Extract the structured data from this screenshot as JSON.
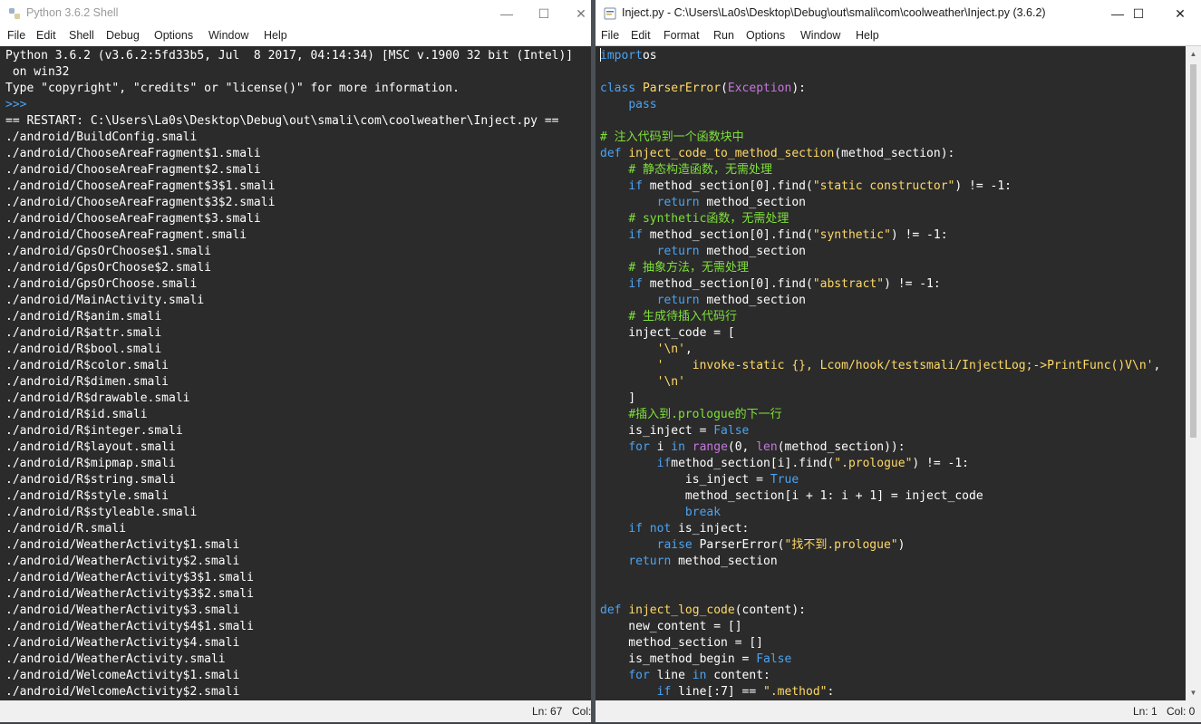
{
  "shell": {
    "title": "Python 3.6.2 Shell",
    "menu": [
      "File",
      "Edit",
      "Shell",
      "Debug",
      "Options",
      "Window",
      "Help"
    ],
    "banner": [
      "Python 3.6.2 (v3.6.2:5fd33b5, Jul  8 2017, 04:14:34) [MSC v.1900 32 bit (Intel)]",
      " on win32",
      "Type \"copyright\", \"credits\" or \"license()\" for more information."
    ],
    "prompt": ">>> ",
    "restart_line": "== RESTART: C:\\Users\\La0s\\Desktop\\Debug\\out\\smali\\com\\coolweather\\Inject.py ==",
    "output": [
      "./android/BuildConfig.smali",
      "./android/ChooseAreaFragment$1.smali",
      "./android/ChooseAreaFragment$2.smali",
      "./android/ChooseAreaFragment$3$1.smali",
      "./android/ChooseAreaFragment$3$2.smali",
      "./android/ChooseAreaFragment$3.smali",
      "./android/ChooseAreaFragment.smali",
      "./android/GpsOrChoose$1.smali",
      "./android/GpsOrChoose$2.smali",
      "./android/GpsOrChoose.smali",
      "./android/MainActivity.smali",
      "./android/R$anim.smali",
      "./android/R$attr.smali",
      "./android/R$bool.smali",
      "./android/R$color.smali",
      "./android/R$dimen.smali",
      "./android/R$drawable.smali",
      "./android/R$id.smali",
      "./android/R$integer.smali",
      "./android/R$layout.smali",
      "./android/R$mipmap.smali",
      "./android/R$string.smali",
      "./android/R$style.smali",
      "./android/R$styleable.smali",
      "./android/R.smali",
      "./android/WeatherActivity$1.smali",
      "./android/WeatherActivity$2.smali",
      "./android/WeatherActivity$3$1.smali",
      "./android/WeatherActivity$3$2.smali",
      "./android/WeatherActivity$3.smali",
      "./android/WeatherActivity$4$1.smali",
      "./android/WeatherActivity$4.smali",
      "./android/WeatherActivity.smali",
      "./android/WelcomeActivity$1.smali",
      "./android/WelcomeActivity$2.smali"
    ],
    "status": {
      "ln": "Ln: 67",
      "col": "Col:"
    }
  },
  "editor": {
    "title": "Inject.py - C:\\Users\\La0s\\Desktop\\Debug\\out\\smali\\com\\coolweather\\Inject.py (3.6.2)",
    "menu": [
      "File",
      "Edit",
      "Format",
      "Run",
      "Options",
      "Window",
      "Help"
    ],
    "code": [
      [
        [
          "kw",
          "import"
        ],
        [
          "",
          "os"
        ]
      ],
      [],
      [
        [
          "kw",
          "class "
        ],
        [
          "cls",
          "ParserError"
        ],
        [
          "",
          "("
        ],
        [
          "bi",
          "Exception"
        ],
        [
          "",
          "):"
        ]
      ],
      [
        [
          "",
          "    "
        ],
        [
          "kw",
          "pass"
        ]
      ],
      [],
      [
        [
          "cm",
          "# 注入代码到一个函数块中"
        ]
      ],
      [
        [
          "kw",
          "def "
        ],
        [
          "cls",
          "inject_code_to_method_section"
        ],
        [
          "",
          "(method_section):"
        ]
      ],
      [
        [
          "",
          "    "
        ],
        [
          "cm",
          "# 静态构造函数，无需处理"
        ]
      ],
      [
        [
          "",
          "    "
        ],
        [
          "kw",
          "if"
        ],
        [
          "",
          " method_section[0].find("
        ],
        [
          "st",
          "\"static constructor\""
        ],
        [
          "",
          ") != -1:"
        ]
      ],
      [
        [
          "",
          "        "
        ],
        [
          "kw",
          "return"
        ],
        [
          "",
          " method_section"
        ]
      ],
      [
        [
          "",
          "    "
        ],
        [
          "cm",
          "# synthetic函数，无需处理"
        ]
      ],
      [
        [
          "",
          "    "
        ],
        [
          "kw",
          "if"
        ],
        [
          "",
          " method_section[0].find("
        ],
        [
          "st",
          "\"synthetic\""
        ],
        [
          "",
          ") != -1:"
        ]
      ],
      [
        [
          "",
          "        "
        ],
        [
          "kw",
          "return"
        ],
        [
          "",
          " method_section"
        ]
      ],
      [
        [
          "",
          "    "
        ],
        [
          "cm",
          "# 抽象方法，无需处理"
        ]
      ],
      [
        [
          "",
          "    "
        ],
        [
          "kw",
          "if"
        ],
        [
          "",
          " method_section[0].find("
        ],
        [
          "st",
          "\"abstract\""
        ],
        [
          "",
          ") != -1:"
        ]
      ],
      [
        [
          "",
          "        "
        ],
        [
          "kw",
          "return"
        ],
        [
          "",
          " method_section"
        ]
      ],
      [
        [
          "",
          "    "
        ],
        [
          "cm",
          "# 生成待插入代码行"
        ]
      ],
      [
        [
          "",
          "    inject_code = ["
        ]
      ],
      [
        [
          "",
          "        "
        ],
        [
          "st",
          "'\\n'"
        ],
        [
          "",
          ","
        ]
      ],
      [
        [
          "",
          "        "
        ],
        [
          "st",
          "'    invoke-static {}, Lcom/hook/testsmali/InjectLog;->PrintFunc()V\\n'"
        ],
        [
          "",
          ","
        ]
      ],
      [
        [
          "",
          "        "
        ],
        [
          "st",
          "'\\n'"
        ]
      ],
      [
        [
          "",
          "    ]"
        ]
      ],
      [
        [
          "",
          "    "
        ],
        [
          "cm",
          "#插入到.prologue的下一行"
        ]
      ],
      [
        [
          "",
          "    is_inject = "
        ],
        [
          "kw",
          "False"
        ]
      ],
      [
        [
          "",
          "    "
        ],
        [
          "kw",
          "for"
        ],
        [
          "",
          " i "
        ],
        [
          "kw",
          "in"
        ],
        [
          "",
          ""
        ],
        [
          "bi",
          " range"
        ],
        [
          "",
          "(0, "
        ],
        [
          "bi",
          "len"
        ],
        [
          "",
          "(method_section)):"
        ]
      ],
      [
        [
          "",
          "        "
        ],
        [
          "kw",
          "if"
        ],
        [
          "",
          "",
          " "
        ],
        [
          "",
          ""
        ],
        [
          "",
          "method_section[i].find("
        ],
        [
          "st",
          "\".prologue\""
        ],
        [
          "",
          ") != -1:"
        ]
      ],
      [
        [
          "",
          "            is_inject = "
        ],
        [
          "kw",
          "True"
        ]
      ],
      [
        [
          "",
          "            method_section[i + 1: i + 1] = inject_code"
        ]
      ],
      [
        [
          "",
          "            "
        ],
        [
          "kw",
          "break"
        ]
      ],
      [
        [
          "",
          "    "
        ],
        [
          "kw",
          "if not"
        ],
        [
          "",
          " is_inject:"
        ]
      ],
      [
        [
          "",
          "        "
        ],
        [
          "kw",
          "raise"
        ],
        [
          "",
          " ParserError("
        ],
        [
          "st",
          "\"找不到.prologue\""
        ],
        [
          "",
          ")"
        ]
      ],
      [
        [
          "",
          "    "
        ],
        [
          "kw",
          "return"
        ],
        [
          "",
          " method_section"
        ]
      ],
      [],
      [],
      [
        [
          "kw",
          "def "
        ],
        [
          "cls",
          "inject_log_code"
        ],
        [
          "",
          "(content):"
        ]
      ],
      [
        [
          "",
          "    new_content = []"
        ]
      ],
      [
        [
          "",
          "    method_section = []"
        ]
      ],
      [
        [
          "",
          "    is_method_begin = "
        ],
        [
          "kw",
          "False"
        ]
      ],
      [
        [
          "",
          "    "
        ],
        [
          "kw",
          "for"
        ],
        [
          "",
          " line "
        ],
        [
          "kw",
          "in"
        ],
        [
          "",
          " content:"
        ]
      ],
      [
        [
          "",
          "        "
        ],
        [
          "kw",
          "if"
        ],
        [
          "",
          " line[:7] == "
        ],
        [
          "st",
          "\".method\""
        ],
        [
          "",
          ":"
        ]
      ]
    ],
    "status": {
      "ln": "Ln: 1",
      "col": "Col: 0"
    }
  },
  "colors": {
    "editor_bg": "#2b2b2b",
    "keyword": "#4ba3f2",
    "string": "#ffd966",
    "comment": "#7ee03a",
    "builtin": "#c677dd"
  },
  "icons": [
    "python-idle-icon",
    "minimize-icon",
    "maximize-icon",
    "close-icon"
  ]
}
